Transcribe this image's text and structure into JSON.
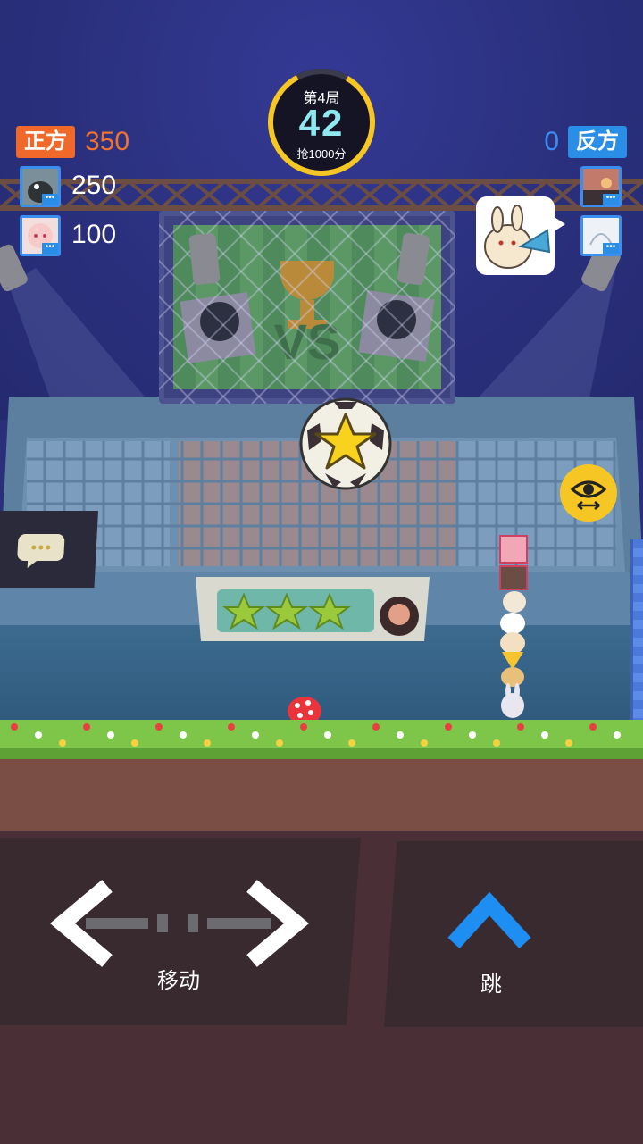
{
  "hud": {
    "team_left": {
      "label": "正方",
      "score": "350",
      "color": "#f0682a"
    },
    "team_right": {
      "label": "反方",
      "score": "0",
      "color": "#2a8de6"
    },
    "left_players": [
      {
        "score": "250",
        "avatar": "dog-avatar"
      },
      {
        "score": "100",
        "avatar": "anime-girl-avatar"
      }
    ],
    "right_players": [
      {
        "avatar": "sunset-avatar"
      },
      {
        "avatar": "sketch-avatar"
      }
    ],
    "more_glyph": "•••"
  },
  "timer": {
    "round": "第4局",
    "countdown": "42",
    "bonus": "抢1000分",
    "ring_color": "#f6c625"
  },
  "controls": {
    "move_label": "移动",
    "jump_label": "跳"
  },
  "scene": {
    "screen_text": "VS",
    "ball": "star-soccer-ball",
    "banner_stars": 3
  }
}
